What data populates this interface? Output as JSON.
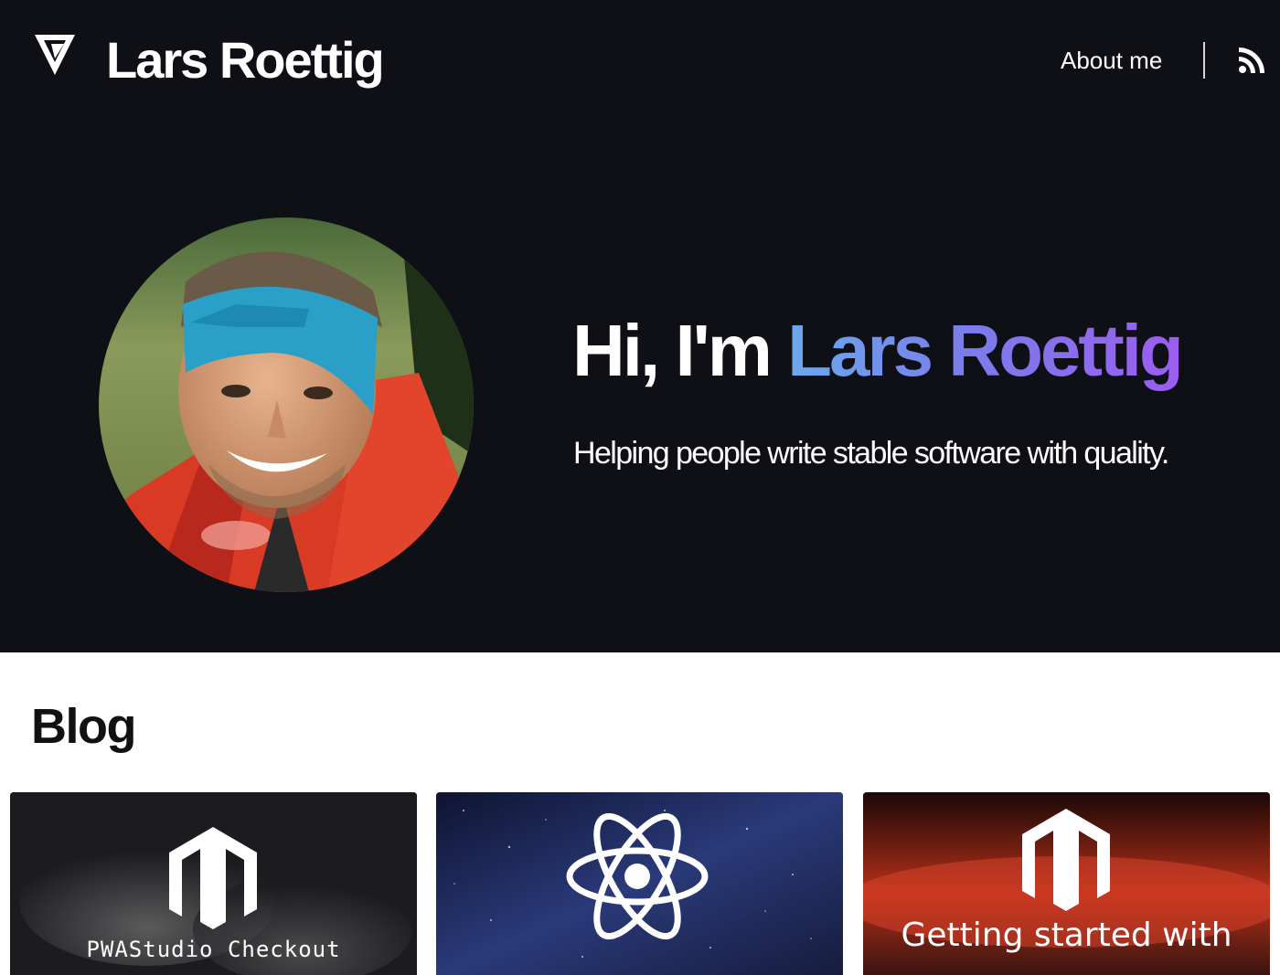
{
  "header": {
    "site_title": "Lars Roettig",
    "nav": {
      "about_label": "About me"
    },
    "icons": {
      "logo": "v-logo-icon",
      "feed": "rss-icon"
    }
  },
  "hero": {
    "greeting": "Hi, I'm",
    "name": "Lars Roettig",
    "subtitle": "Helping people write stable software with quality.",
    "avatar_alt": "Portrait of Lars Roettig wearing a blue headband and red jacket"
  },
  "blog": {
    "title": "Blog",
    "posts": [
      {
        "caption": "PWAStudio Checkout",
        "icon": "magento-icon"
      },
      {
        "caption": "",
        "icon": "react-icon"
      },
      {
        "caption": "Getting started with",
        "icon": "magento-icon"
      }
    ]
  },
  "colors": {
    "hero_background": "#0f0f16",
    "name_gradient_start": "#6aa9ee",
    "name_gradient_end": "#9b5df0"
  }
}
